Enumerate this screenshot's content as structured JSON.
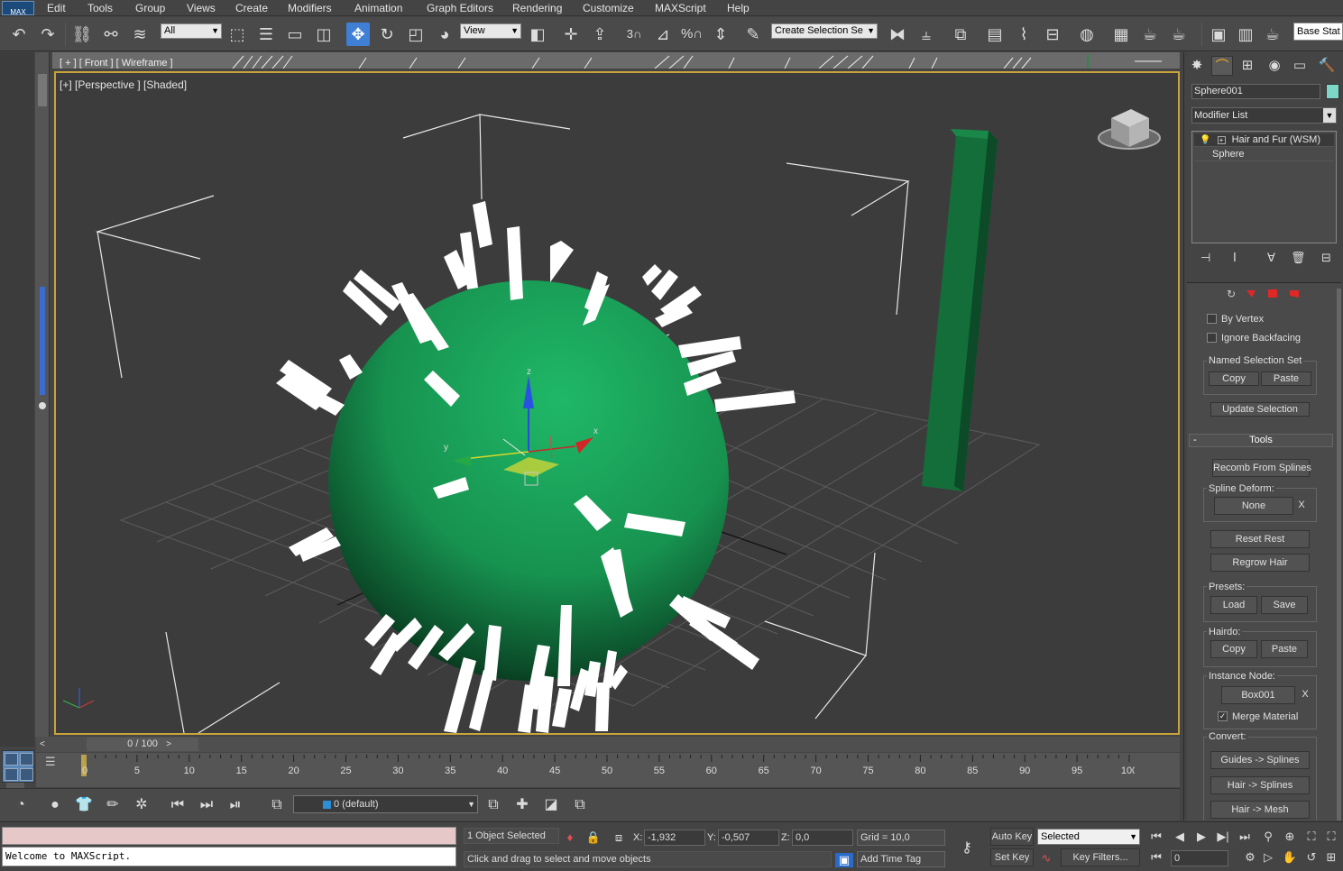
{
  "app": {
    "logo": "MAX"
  },
  "menu": [
    "Edit",
    "Tools",
    "Group",
    "Views",
    "Create",
    "Modifiers",
    "Animation",
    "Graph Editors",
    "Rendering",
    "Customize",
    "MAXScript",
    "Help"
  ],
  "toolbar": {
    "selection_filter": "All",
    "ref_coord": "View",
    "named_selection": "Create Selection Se",
    "base_stat": "Base Stat",
    "snap_3": "3",
    "percent_snap": "%"
  },
  "viewports": {
    "front_label": "[ + ] [ Front ] [ Wireframe ]",
    "persp_label": "[+] [Perspective ] [Shaded]"
  },
  "gizmo_labels": {
    "x": "x",
    "y": "y",
    "z": "z"
  },
  "timeline": {
    "slider_label": "0 / 100",
    "ticks": [
      "0",
      "5",
      "10",
      "15",
      "20",
      "25",
      "30",
      "35",
      "40",
      "45",
      "50",
      "55",
      "60",
      "65",
      "70",
      "75",
      "80",
      "85",
      "90",
      "95",
      "100"
    ]
  },
  "layer": {
    "current": "0 (default)"
  },
  "status": {
    "maxscript_output": "Welcome to MAXScript.",
    "selection": "1 Object Selected",
    "prompt": "Click and drag to select and move objects",
    "x_label": "X:",
    "x_value": "-1,932",
    "y_label": "Y:",
    "y_value": "-0,507",
    "z_label": "Z:",
    "z_value": "0,0",
    "grid": "Grid = 10,0",
    "add_time_tag": "Add Time Tag",
    "auto_key": "Auto Key",
    "set_key": "Set Key",
    "key_mode": "Selected",
    "key_filters": "Key Filters...",
    "frame": "0"
  },
  "command_panel": {
    "object_name": "Sphere001",
    "object_color": "#7ed6c6",
    "modifier_list": "Modifier List",
    "stack": [
      "Hair and Fur (WSM)",
      "Sphere"
    ],
    "by_vertex": "By Vertex",
    "ignore_backfacing": "Ignore Backfacing",
    "named_selection_set": "Named Selection Set",
    "copy": "Copy",
    "paste": "Paste",
    "update_selection": "Update Selection",
    "tools_rollout": "Tools",
    "recomb": "Recomb From Splines",
    "spline_deform": "Spline Deform:",
    "none": "None",
    "x": "X",
    "reset_rest": "Reset Rest",
    "regrow_hair": "Regrow Hair",
    "presets": "Presets:",
    "load": "Load",
    "save": "Save",
    "hairdo": "Hairdo:",
    "instance_node": "Instance Node:",
    "instance_value": "Box001",
    "merge_material": "Merge Material",
    "convert": "Convert:",
    "guides_splines": "Guides -> Splines",
    "hair_splines": "Hair -> Splines",
    "hair_mesh": "Hair -> Mesh"
  },
  "colors": {
    "active_viewport_border": "#c9a33b",
    "sphere": "#1a9a55",
    "accent_blue": "#3f7fd6"
  }
}
